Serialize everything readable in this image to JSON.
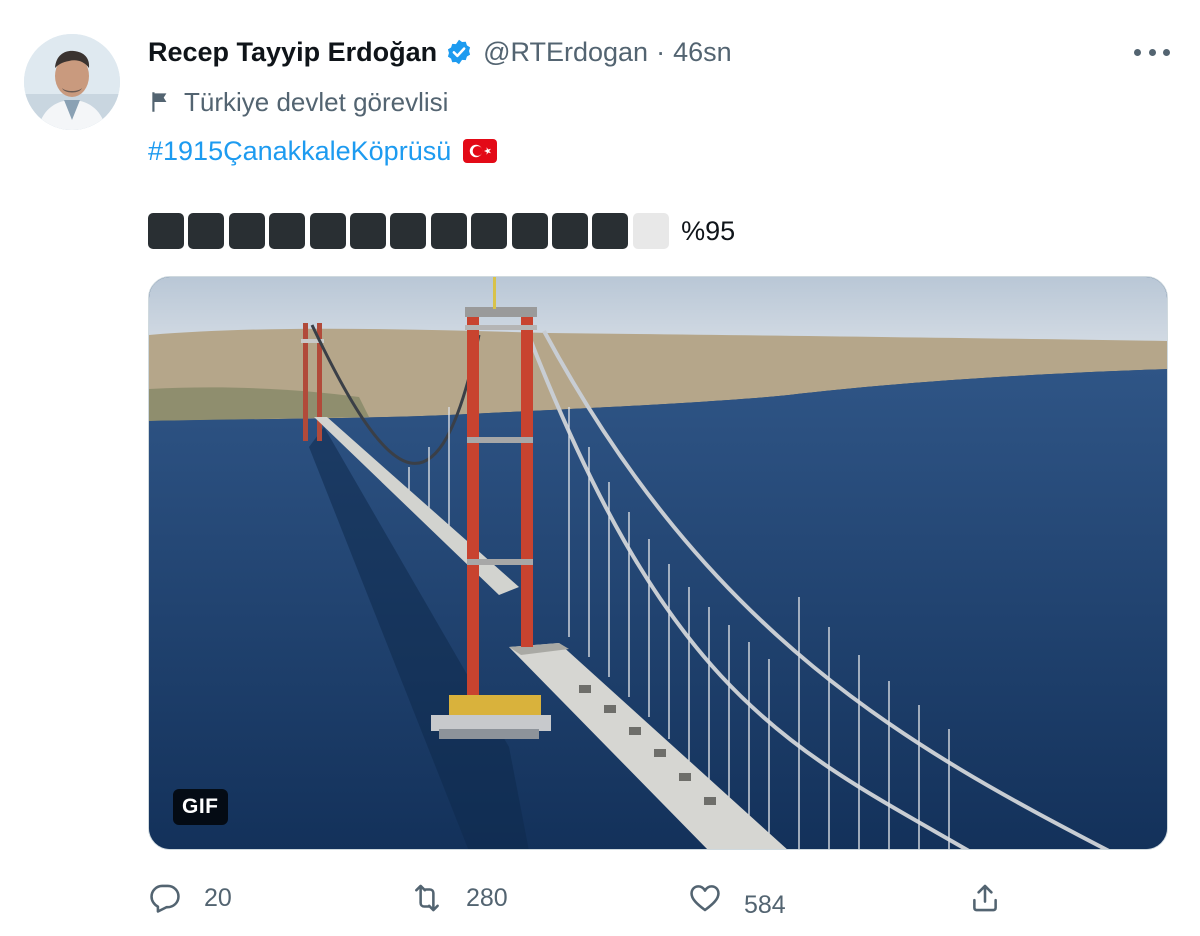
{
  "tweet": {
    "author_name": "Recep Tayyip Erdoğan",
    "handle": "@RTErdogan",
    "separator": "·",
    "time": "46sn",
    "label": "Türkiye devlet görevlisi",
    "hashtag": "#1915ÇanakkaleKöprüsü",
    "progress": {
      "filled_blocks": 12,
      "total_blocks": 13,
      "text": "%95",
      "fraction": 0.95
    },
    "media": {
      "badge": "GIF",
      "description_icon": "bridge-image"
    },
    "actions": {
      "reply_count": "20",
      "retweet_count": "280",
      "like_count": "584"
    }
  },
  "colors": {
    "accent": "#1d9bf0",
    "secondary_text": "#536471",
    "flag_red": "#e30a17",
    "progress_filled": "#292f33",
    "progress_empty": "#e8e8e8"
  },
  "icons": {
    "verified": "verified-badge-icon",
    "label": "flag-icon",
    "more": "more-options-icon",
    "reply": "reply-icon",
    "retweet": "retweet-icon",
    "like": "heart-icon",
    "share": "share-icon"
  }
}
